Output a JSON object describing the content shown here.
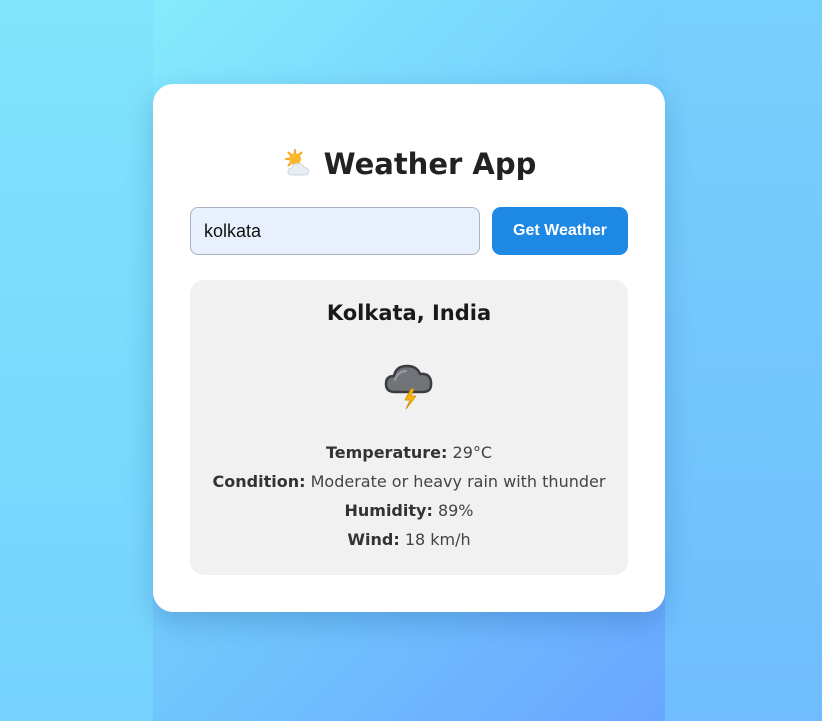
{
  "app": {
    "title": "Weather App",
    "title_icon": "sun-behind-cloud-icon"
  },
  "search": {
    "value": "kolkata",
    "button_label": "Get Weather"
  },
  "result": {
    "location": "Kolkata, India",
    "condition_icon": "thunder-cloud-icon",
    "details": [
      {
        "label": "Temperature:",
        "value": "29°C"
      },
      {
        "label": "Condition:",
        "value": "Moderate or heavy rain with thunder"
      },
      {
        "label": "Humidity:",
        "value": "89%"
      },
      {
        "label": "Wind:",
        "value": "18 km/h"
      }
    ]
  },
  "colors": {
    "accent": "#1e88e5",
    "card": "#ffffff",
    "result_panel": "#f1f1f1",
    "input_bg": "#e8f0fe"
  }
}
